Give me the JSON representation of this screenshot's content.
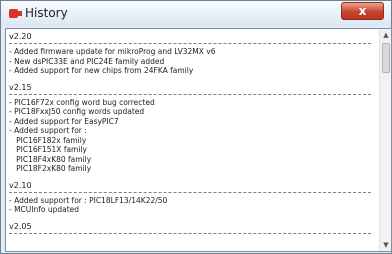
{
  "window": {
    "title": "History",
    "close_symbol": "x",
    "icon": "app-icon"
  },
  "history": [
    {
      "version": "v2.20",
      "items": [
        "- Added firmware update for mikroProg and LV32MX v6",
        "- New dsPIC33E and PIC24E family added",
        "- Added support for new chips from 24FKA family"
      ]
    },
    {
      "version": "v2.15",
      "items": [
        "- PIC16F72x config word bug corrected",
        "- PIC18FxxJ50 config words updated",
        "- Added support for EasyPIC7",
        "- Added support for :",
        "   PIC16F182x family",
        "   PIC16F151X family",
        "   PIC18F4xK80 family",
        "   PIC18F2xK80 family"
      ]
    },
    {
      "version": "v2.10",
      "items": [
        "- Added support for : PIC18LF13/14K22/50",
        "- MCUInfo updated"
      ]
    },
    {
      "version": "v2.05",
      "items": []
    }
  ],
  "scrollbar": {
    "up_arrow": "▲",
    "down_arrow": "▼"
  },
  "colors": {
    "close_button": "#c7442d",
    "app_icon": "#d7332a"
  }
}
